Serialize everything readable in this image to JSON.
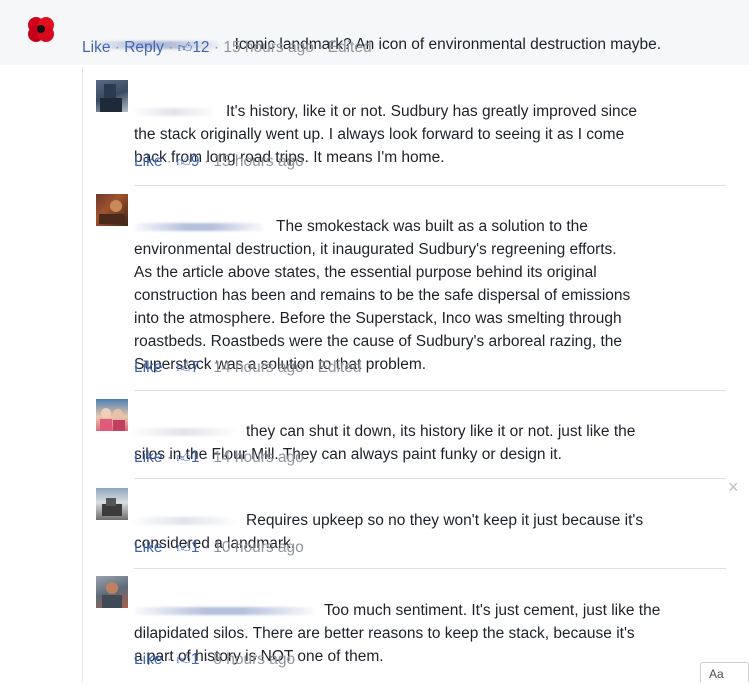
{
  "meta_labels": {
    "like": "Like",
    "reply": "Reply",
    "separator": "·"
  },
  "colors": {
    "link": "#4267b2",
    "meta_gray": "#90949c",
    "text": "#1d2129",
    "top_bg": "#f6f7f9",
    "poppy_red": "#d0021b"
  },
  "comments": [
    {
      "avatar_icon": "poppy-icon",
      "text": "Iconic landmark? An icon of environmental destruction maybe.",
      "likes": "12",
      "time": "15 hours ago",
      "edited": "Edited",
      "has_reply": true
    },
    {
      "avatar_icon": "user-avatar",
      "lines": [
        "It's history, like it or not. Sudbury has greatly improved since",
        "the stack originally went up. I always look forward to seeing it as I come",
        "back from long road trips. It means I'm home."
      ],
      "likes": "9",
      "time": "15 hours ago"
    },
    {
      "avatar_icon": "user-avatar",
      "lines": [
        "The smokestack was built as a solution to the",
        "environmental destruction, it inaugurated Sudbury's regreening efforts.",
        "As the article above states, the essential purpose behind its original",
        "construction has been and remains to be the safe dispersal of emissions",
        "into the atmosphere. Before the Superstack, Inco was smelting through",
        "roastbeds. Roastbeds were the cause of Sudbury's arboreal razing, the",
        "Superstack was a solution to that problem."
      ],
      "likes": "7",
      "time": "14 hours ago",
      "edited": "Edited"
    },
    {
      "avatar_icon": "user-avatar",
      "lines": [
        "they can shut it down, its history like it or not. just like the",
        "silos in the Flour Mill. They can always paint funky or design it."
      ],
      "likes": "1",
      "time": "14 hours ago"
    },
    {
      "avatar_icon": "user-avatar",
      "lines": [
        "Requires upkeep so no they won't keep it just because it's",
        "considered a landmark."
      ],
      "likes": "1",
      "time": "10 hours ago",
      "close_glyph": "×"
    },
    {
      "avatar_icon": "user-avatar",
      "lines": [
        "Too much sentiment. It's just cement, just like the",
        "dilapidated silos. There are better reasons to keep the stack, because it's",
        "a part of history is NOT one of them."
      ],
      "likes": "1",
      "time": "8 hours ago"
    }
  ],
  "corner_label": "Aa"
}
